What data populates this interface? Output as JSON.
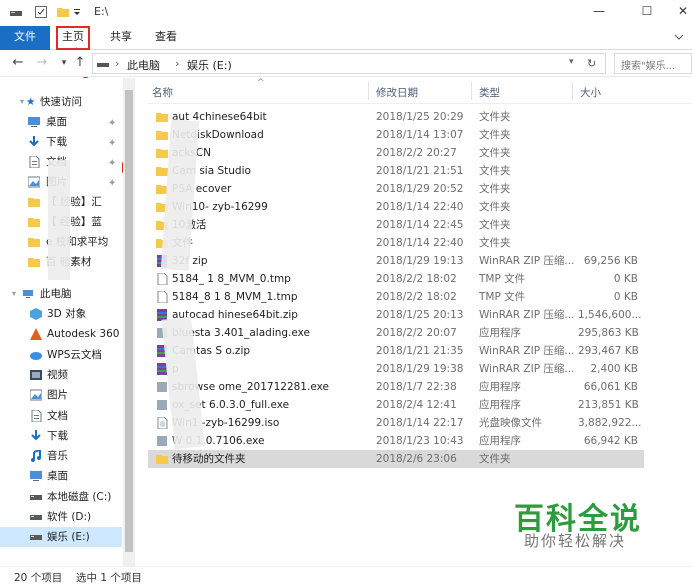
{
  "window": {
    "path": "E:\\"
  },
  "ribbon": {
    "tabs": [
      "文件",
      "主页",
      "共享",
      "查看"
    ]
  },
  "address": {
    "crumbs": [
      "此电脑",
      "娱乐 (E:)"
    ],
    "search_placeholder": "搜索\"娱乐..."
  },
  "nav": {
    "quick_access": "快速访问",
    "items": [
      {
        "label": "桌面",
        "pinned": true,
        "icon": "desktop-icon"
      },
      {
        "label": "下载",
        "pinned": true,
        "icon": "download-icon"
      },
      {
        "label": "文档",
        "pinned": true,
        "icon": "document-icon"
      },
      {
        "label": "图片",
        "pinned": true,
        "icon": "picture-icon"
      },
      {
        "label": "【  经验】汇",
        "pinned": false,
        "icon": "folder-icon"
      },
      {
        "label": "【  经验】蓝",
        "pinned": false,
        "icon": "folder-icon"
      },
      {
        "label": "e  校和求平均",
        "pinned": false,
        "icon": "folder-icon"
      },
      {
        "label": "百  验素材",
        "pinned": false,
        "icon": "folder-icon"
      }
    ],
    "this_pc": "此电脑",
    "pc_items": [
      {
        "label": "3D 对象",
        "icon": "cube-icon"
      },
      {
        "label": "Autodesk 360",
        "icon": "autodesk-icon"
      },
      {
        "label": "WPS云文档",
        "icon": "cloud-icon"
      },
      {
        "label": "视频",
        "icon": "video-icon"
      },
      {
        "label": "图片",
        "icon": "picture-icon"
      },
      {
        "label": "文档",
        "icon": "document-icon"
      },
      {
        "label": "下载",
        "icon": "download-icon"
      },
      {
        "label": "音乐",
        "icon": "music-icon"
      },
      {
        "label": "桌面",
        "icon": "desktop-icon"
      },
      {
        "label": "本地磁盘 (C:)",
        "icon": "drive-icon"
      },
      {
        "label": "软件 (D:)",
        "icon": "drive-icon"
      },
      {
        "label": "娱乐 (E:)",
        "icon": "drive-icon"
      }
    ]
  },
  "columns": {
    "name": "名称",
    "date": "修改日期",
    "type": "类型",
    "size": "大小"
  },
  "files": [
    {
      "name": "aut    4chinese64bit",
      "date": "2018/1/25 20:29",
      "type": "文件夹",
      "size": "",
      "icon": "folder-icon"
    },
    {
      "name": "   NetdiskDownload",
      "date": "2018/1/14 13:07",
      "type": "文件夹",
      "size": "",
      "icon": "folder-icon"
    },
    {
      "name": "   acksCN",
      "date": "2018/2/2 20:27",
      "type": "文件夹",
      "size": "",
      "icon": "folder-icon"
    },
    {
      "name": "Cam   sia Studio",
      "date": "2018/1/21 21:51",
      "type": "文件夹",
      "size": "",
      "icon": "folder-icon"
    },
    {
      "name": "PSA    ecover",
      "date": "2018/1/29 20:52",
      "type": "文件夹",
      "size": "",
      "icon": "folder-icon"
    },
    {
      "name": "Win10-    zyb-16299",
      "date": "2018/1/14 22:40",
      "type": "文件夹",
      "size": "",
      "icon": "folder-icon"
    },
    {
      "name": "  10激活",
      "date": "2018/1/14 22:45",
      "type": "文件夹",
      "size": "",
      "icon": "folder-icon"
    },
    {
      "name": "   文件",
      "date": "2018/1/14 22:40",
      "type": "文件夹",
      "size": "",
      "icon": "folder-icon"
    },
    {
      "name": "32f   zip",
      "date": "2018/1/29 19:13",
      "type": "WinRAR ZIP 压缩...",
      "size": "69,256 KB",
      "icon": "archive-icon"
    },
    {
      "name": "5184_   1  8_MVM_0.tmp",
      "date": "2018/2/2 18:02",
      "type": "TMP 文件",
      "size": "0 KB",
      "icon": "file-icon"
    },
    {
      "name": "5184_8   1   8_MVM_1.tmp",
      "date": "2018/2/2 18:02",
      "type": "TMP 文件",
      "size": "0 KB",
      "icon": "file-icon"
    },
    {
      "name": "autocad   hinese64bit.zip",
      "date": "2018/1/25 20:13",
      "type": "WinRAR ZIP 压缩...",
      "size": "1,546,600...",
      "icon": "archive-icon"
    },
    {
      "name": "bluesta   3.401_alading.exe",
      "date": "2018/2/2 20:07",
      "type": "应用程序",
      "size": "295,863 KB",
      "icon": "app-icon"
    },
    {
      "name": "Camtas   S   o.zip",
      "date": "2018/1/21 21:35",
      "type": "WinRAR ZIP 压缩...",
      "size": "293,467 KB",
      "icon": "archive-icon"
    },
    {
      "name": "   p",
      "date": "2018/1/29 19:38",
      "type": "WinRAR ZIP 压缩...",
      "size": "2,400 KB",
      "icon": "archive-icon"
    },
    {
      "name": "  sbrowse   ome_201712281.exe",
      "date": "2018/1/7 22:38",
      "type": "应用程序",
      "size": "66,061 KB",
      "icon": "app-icon"
    },
    {
      "name": "  ox_set   6.0.3.0_full.exe",
      "date": "2018/2/4 12:41",
      "type": "应用程序",
      "size": "213,851 KB",
      "icon": "app-icon"
    },
    {
      "name": "Win1   -zyb-16299.iso",
      "date": "2018/1/14 22:17",
      "type": "光盘映像文件",
      "size": "3,882,922...",
      "icon": "disc-icon"
    },
    {
      "name": "W   0.1.0.7106.exe",
      "date": "2018/1/23 10:43",
      "type": "应用程序",
      "size": "66,942 KB",
      "icon": "app-icon"
    },
    {
      "name": "待移动的文件夹",
      "date": "2018/2/6 23:06",
      "type": "文件夹",
      "size": "",
      "icon": "folder-icon"
    }
  ],
  "status": {
    "count": "20 个项目",
    "selected": "选中 1 个项目"
  },
  "watermark": {
    "title": "百科全说",
    "subtitle": "助你轻松解决"
  },
  "colors": {
    "accent": "#1a6fc4",
    "annotation": "#e02a2a",
    "watermark": "#2e9c3e",
    "folder": "#f5c94c"
  }
}
